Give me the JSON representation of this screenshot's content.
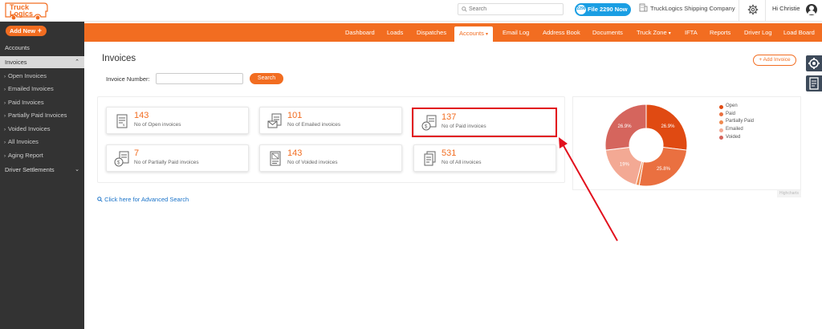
{
  "brand": {
    "logo_line1": "Truck",
    "logo_line2": "Logics"
  },
  "topbar": {
    "search_placeholder": "Search",
    "file_button": "File 2290 Now",
    "file_badge": "2290",
    "company": "TruckLogics Shipping Company",
    "greeting": "Hi Christie"
  },
  "nav": {
    "items": [
      "Dashboard",
      "Loads",
      "Dispatches",
      "Accounts",
      "Email Log",
      "Address Book",
      "Documents",
      "Truck Zone",
      "IFTA",
      "Reports",
      "Driver Log",
      "Load Board"
    ],
    "active": "Accounts"
  },
  "sidebar": {
    "add_new": "Add New",
    "accounts": "Accounts",
    "invoices": "Invoices",
    "items": [
      "Open Invoices",
      "Emailed Invoices",
      "Paid Invoices",
      "Partially Paid Invoices",
      "Voided Invoices",
      "All Invoices",
      "Aging Report"
    ],
    "driver_settlements": "Driver Settlements"
  },
  "main": {
    "title": "Invoices",
    "add_invoice": "Add Invoice",
    "invoice_number_label": "Invoice Number:",
    "invoice_number_value": "",
    "search_button": "Search",
    "advanced_search": "Click here for Advanced Search"
  },
  "cards": [
    {
      "count": "143",
      "label": "No of Open invoices",
      "icon": "open-invoice-icon"
    },
    {
      "count": "101",
      "label": "No of Emailed invoices",
      "icon": "emailed-invoice-icon"
    },
    {
      "count": "137",
      "label": "No of Paid invoices",
      "icon": "paid-invoice-icon"
    },
    {
      "count": "7",
      "label": "No of Partially Paid invoices",
      "icon": "partially-paid-invoice-icon"
    },
    {
      "count": "143",
      "label": "No of Voided invoices",
      "icon": "voided-invoice-icon"
    },
    {
      "count": "531",
      "label": "No of All invoices",
      "icon": "all-invoices-icon"
    }
  ],
  "chart_data": {
    "type": "pie",
    "donut": true,
    "legend": "right",
    "slices": [
      {
        "name": "Open",
        "value": 26.9,
        "label": "26.9%",
        "color": "#e04a12"
      },
      {
        "name": "Paid",
        "value": 25.8,
        "label": "25.8%",
        "color": "#ea7040"
      },
      {
        "name": "Partially Paid",
        "value": 1.3,
        "label": "",
        "color": "#ef8a50"
      },
      {
        "name": "Emailed",
        "value": 19,
        "label": "19%",
        "color": "#f3a994"
      },
      {
        "name": "Voided",
        "value": 26.9,
        "label": "26.9%",
        "color": "#d5655d"
      }
    ],
    "watermark": "Highcharts"
  },
  "colors": {
    "accent": "#f26d21",
    "sidebar": "#333333",
    "highlight": "#e2111d",
    "link": "#1a73c9"
  }
}
